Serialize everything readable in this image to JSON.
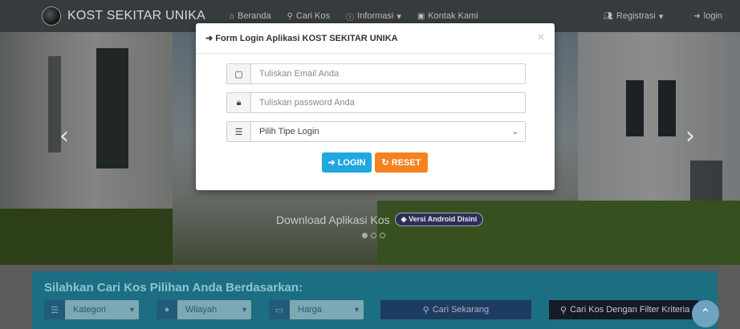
{
  "navbar": {
    "brand": "KOST SEKITAR UNIKA",
    "links": [
      {
        "label": "Beranda",
        "icon": "home-icon"
      },
      {
        "label": "Cari Kos",
        "icon": "search-icon"
      },
      {
        "label": "Informasi",
        "icon": "info-icon",
        "caret": "▾"
      },
      {
        "label": "Kontak Kami",
        "icon": "contact-icon"
      }
    ],
    "register": "Registrasi",
    "register_caret": "▾",
    "login": "login"
  },
  "carousel": {
    "caption": "Download Aplikasi Kos",
    "badge": "◆ Versi Android Disini",
    "slides": 3,
    "active_slide": 1
  },
  "modal": {
    "title": "Form Login Aplikasi KOST SEKITAR UNIKA",
    "close": "×",
    "email_placeholder": "Tuliskan Email Anda",
    "password_placeholder": "Tuliskan password Anda",
    "login_type_selected": "Pilih Tipe Login",
    "login_button": "LOGIN",
    "reset_button": "RESET"
  },
  "search": {
    "title": "Silahkan Cari Kos Pilihan Anda Berdasarkan:",
    "kategori": "Kategori",
    "wilayah": "Wilayah",
    "harga": "Harga",
    "cari_button": "Cari Sekarang",
    "cari_filter_button": "Cari Kos Dengan Filter Kriteria"
  },
  "colors": {
    "login_button": "#1fa8e0",
    "reset_button": "#f58220",
    "search_panel": "#1c6f82"
  }
}
